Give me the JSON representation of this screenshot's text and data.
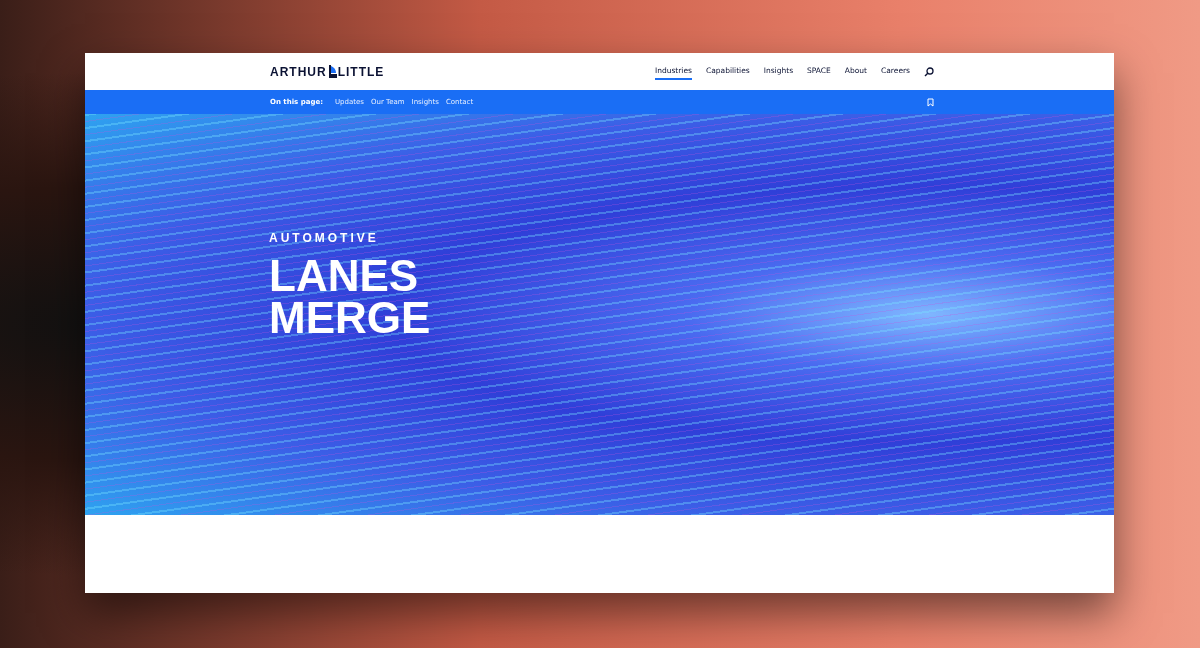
{
  "header": {
    "logo": {
      "left": "ARTHUR",
      "right": "LITTLE"
    },
    "nav": [
      {
        "label": "Industries",
        "selected": true
      },
      {
        "label": "Capabilities",
        "selected": false
      },
      {
        "label": "Insights",
        "selected": false
      },
      {
        "label": "SPACE",
        "selected": false
      },
      {
        "label": "About",
        "selected": false
      },
      {
        "label": "Careers",
        "selected": false
      }
    ]
  },
  "subnav": {
    "label": "On this page:",
    "links": [
      "Updates",
      "Our Team",
      "Insights",
      "Contact"
    ]
  },
  "hero": {
    "eyebrow": "AUTOMOTIVE",
    "title_lines": [
      "LANES",
      "MERGE"
    ]
  }
}
